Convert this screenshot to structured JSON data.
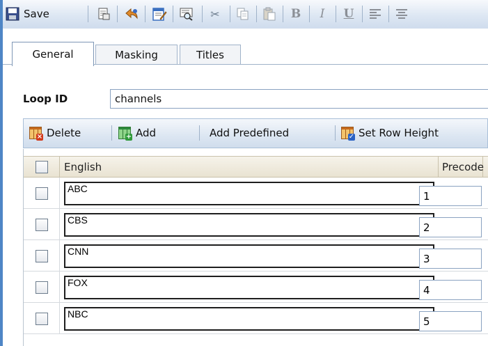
{
  "toolbar": {
    "save_label": "Save",
    "icons": [
      "save-icon",
      "print-preview-icon",
      "undo-icon",
      "edit-icon",
      "find-icon",
      "cut-icon",
      "copy-icon",
      "paste-icon",
      "bold-icon",
      "italic-icon",
      "underline-icon",
      "align-left-icon",
      "align-center-icon"
    ],
    "bold_glyph": "B",
    "italic_glyph": "I",
    "underline_glyph": "U"
  },
  "tabs": [
    {
      "label": "General",
      "active": true
    },
    {
      "label": "Masking",
      "active": false
    },
    {
      "label": "Titles",
      "active": false
    }
  ],
  "loop": {
    "label": "Loop ID",
    "value": "channels"
  },
  "grid_toolbar": {
    "delete_label": "Delete",
    "add_label": "Add",
    "add_predefined_label": "Add Predefined",
    "set_row_height_label": "Set Row Height"
  },
  "table": {
    "columns": [
      "English",
      "Precode"
    ],
    "rows": [
      {
        "english": "ABC",
        "precode": "1"
      },
      {
        "english": "CBS",
        "precode": "2"
      },
      {
        "english": "CNN",
        "precode": "3"
      },
      {
        "english": "FOX",
        "precode": "4"
      },
      {
        "english": "NBC",
        "precode": "5"
      }
    ]
  },
  "colors": {
    "accent_border": "#4f86c6",
    "toolbar_bg": "#dde7f3",
    "header_bg": "#ece6d6"
  }
}
